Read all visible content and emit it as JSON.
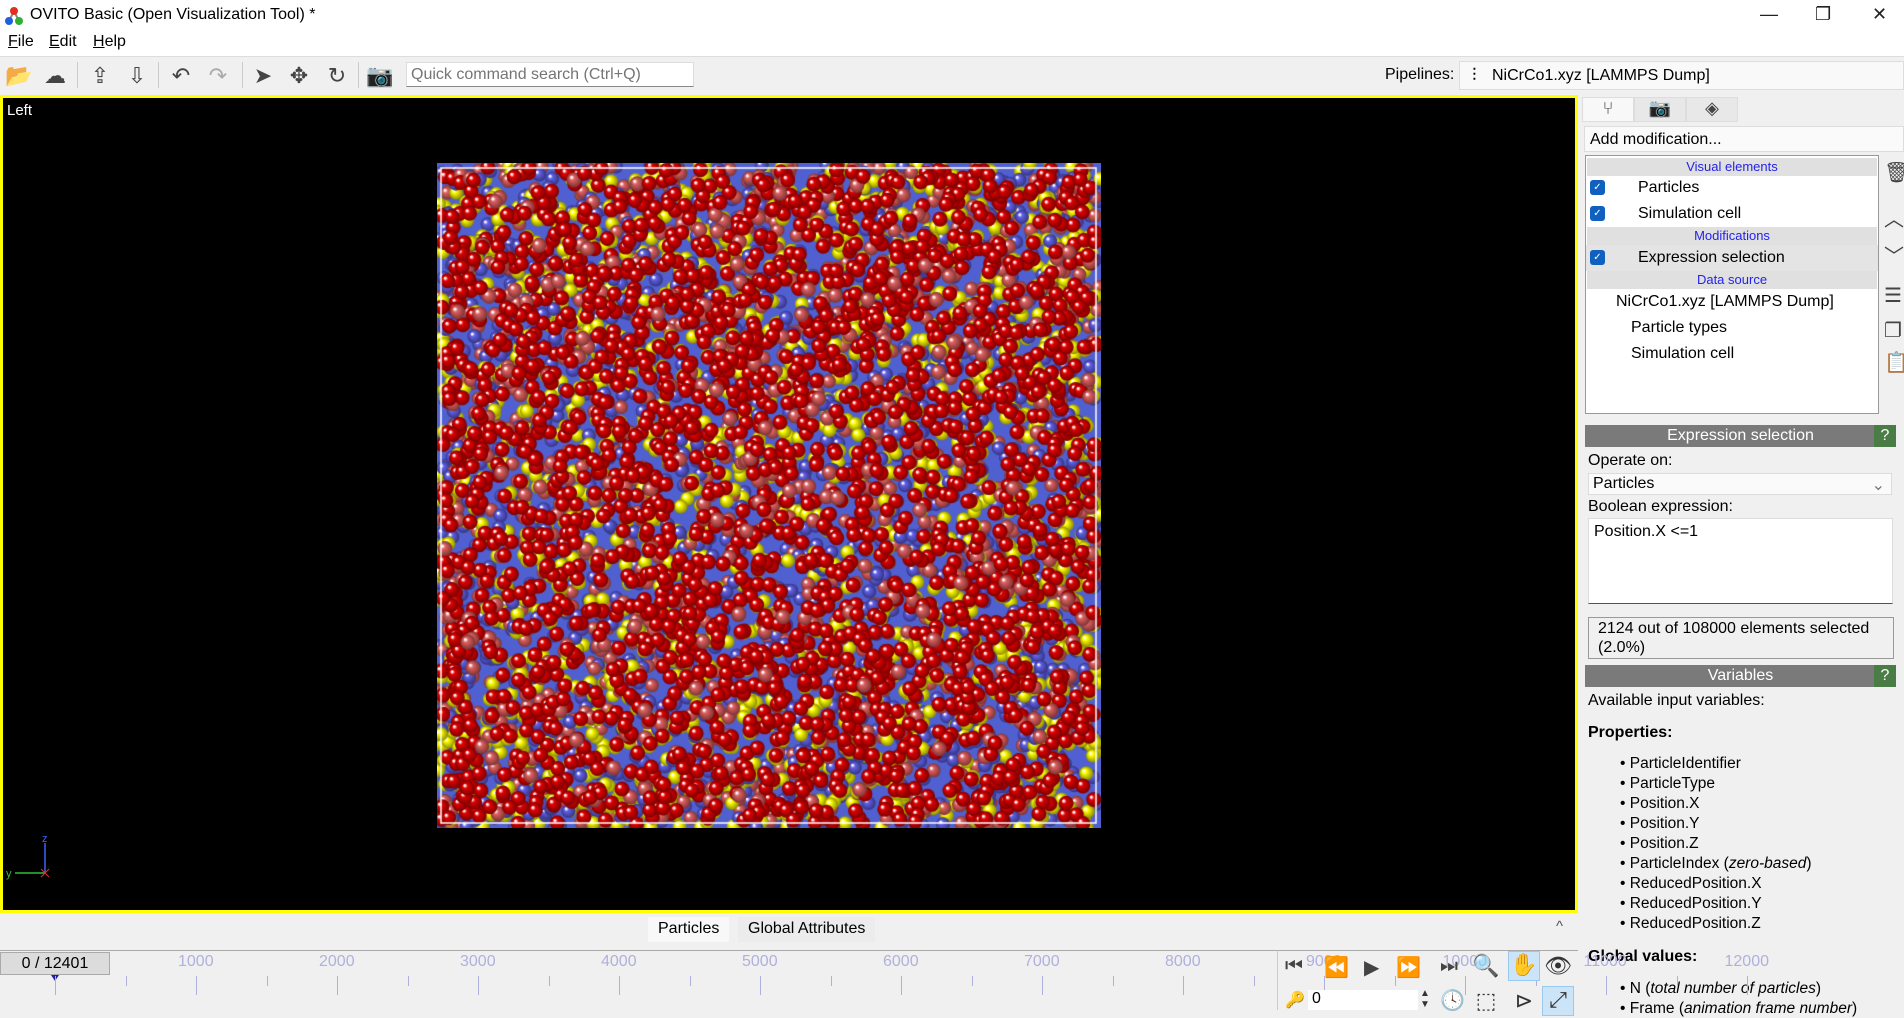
{
  "window": {
    "title": "OVITO Basic (Open Visualization Tool) *",
    "minimize": "—",
    "restore": "❐",
    "close": "✕"
  },
  "menu": [
    {
      "label": "File",
      "key": "F",
      "rest": "ile"
    },
    {
      "label": "Edit",
      "key": "E",
      "rest": "dit"
    },
    {
      "label": "Help",
      "key": "H",
      "rest": "elp"
    }
  ],
  "toolbar": {
    "search_placeholder": "Quick command search (Ctrl+Q)",
    "pipelines_label": "Pipelines:",
    "pipeline_selected": "NiCrCo1.xyz [LAMMPS Dump]"
  },
  "viewport": {
    "label": "Left",
    "axis_z": "z",
    "axis_y": "y",
    "particle_colors": [
      "#e00000",
      "#e06060",
      "#6060e8",
      "#ffff00"
    ],
    "border_color": "#ffff00"
  },
  "pipeline_panel": {
    "add_modification": "Add modification...",
    "sections": {
      "visual": "Visual elements",
      "modifications": "Modifications",
      "data_source": "Data source"
    },
    "visual_items": [
      "Particles",
      "Simulation cell"
    ],
    "modification_items": [
      "Expression selection"
    ],
    "data_source_items": [
      "NiCrCo1.xyz [LAMMPS Dump]",
      "Particle types",
      "Simulation cell"
    ]
  },
  "expression_selection": {
    "title": "Expression selection",
    "help": "?",
    "operate_on_label": "Operate on:",
    "operate_on_value": "Particles",
    "boolean_label": "Boolean expression:",
    "expression": "Position.X <=1",
    "result_line1": "2124 out of 108000 elements selected",
    "result_line2": "(2.0%)"
  },
  "variables": {
    "title": "Variables",
    "help": "?",
    "intro": "Available input variables:",
    "properties_label": "Properties:",
    "properties": [
      "ParticleIdentifier",
      "ParticleType",
      "Position.X",
      "Position.Y",
      "Position.Z",
      "ParticleIndex",
      "ReducedPosition.X",
      "ReducedPosition.Y",
      "ReducedPosition.Z"
    ],
    "particle_index_note": "zero-based",
    "global_label": "Global values:",
    "globals": [
      {
        "name": "N",
        "note": "total number of particles"
      },
      {
        "name": "Frame",
        "note": "animation frame number"
      }
    ]
  },
  "bottom": {
    "tabs": [
      "Particles",
      "Global Attributes"
    ],
    "collapse": "^"
  },
  "timeline": {
    "frame_display": "0 / 12401",
    "ticks": [
      "1000",
      "2000",
      "3000",
      "4000",
      "5000",
      "6000",
      "7000",
      "8000",
      "9000",
      "10000",
      "11000",
      "12000"
    ],
    "current_frame": 0,
    "max_frame": 12401
  },
  "animation": {
    "spinner_value": "0"
  }
}
